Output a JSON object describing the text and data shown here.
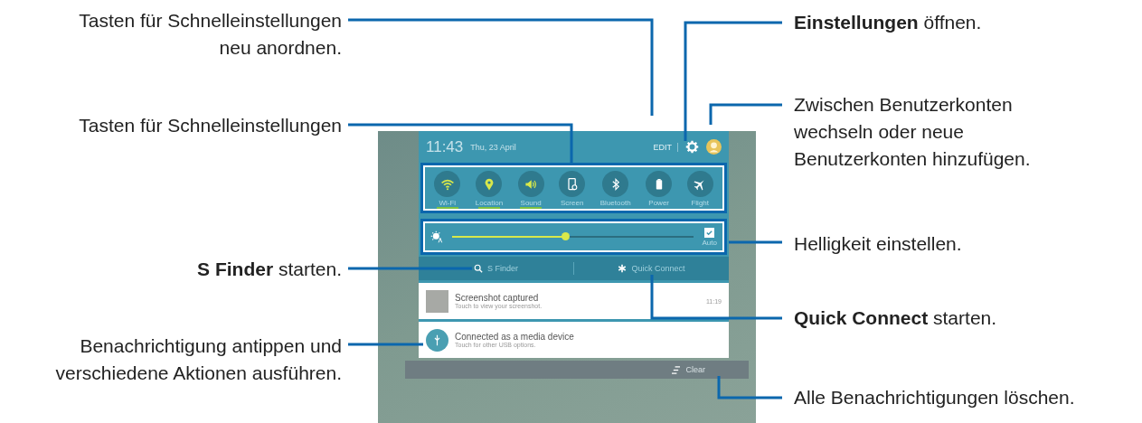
{
  "callouts_left": [
    {
      "text": "Tasten für Schnelleinstellungen neu anordnen."
    },
    {
      "text": "Tasten für Schnelleinstellungen"
    },
    {
      "text": "**S Finder** starten."
    },
    {
      "text": "Benachrichtigung antippen und verschiedene Aktionen ausführen."
    }
  ],
  "callouts_right": [
    {
      "text": "**Einstellungen** öffnen."
    },
    {
      "text": "Zwischen Benutzerkonten wechseln oder neue Benutzerkonten hinzufügen."
    },
    {
      "text": "Helligkeit einstellen."
    },
    {
      "text": "**Quick Connect** starten."
    },
    {
      "text": "Alle Benachrichtigungen löschen."
    }
  ],
  "panel": {
    "time": "11:43",
    "date": "Thu, 23 April",
    "edit": "EDIT",
    "quick_settings": [
      {
        "kind": "wifi",
        "label": "Wi-Fi",
        "on": true
      },
      {
        "kind": "location",
        "label": "Location",
        "on": true
      },
      {
        "kind": "sound",
        "label": "Sound",
        "on": true
      },
      {
        "kind": "screen",
        "label": "Screen",
        "on": false
      },
      {
        "kind": "bluetooth",
        "label": "Bluetooth",
        "on": false
      },
      {
        "kind": "power",
        "label": "Power",
        "on": false
      },
      {
        "kind": "flight",
        "label": "Flight",
        "on": false
      }
    ],
    "brightness": {
      "level": 0.47,
      "auto": {
        "label": "Auto",
        "checked": true
      }
    },
    "s_finder": "S Finder",
    "quick_connect": "Quick Connect",
    "notifications": [
      {
        "kind": "screenshot",
        "title": "Screenshot captured",
        "subtitle": "Touch to view your screenshot.",
        "time": "11:19"
      },
      {
        "kind": "usb",
        "title": "Connected as a media device",
        "subtitle": "Touch for other USB options."
      }
    ],
    "clear": "Clear"
  }
}
